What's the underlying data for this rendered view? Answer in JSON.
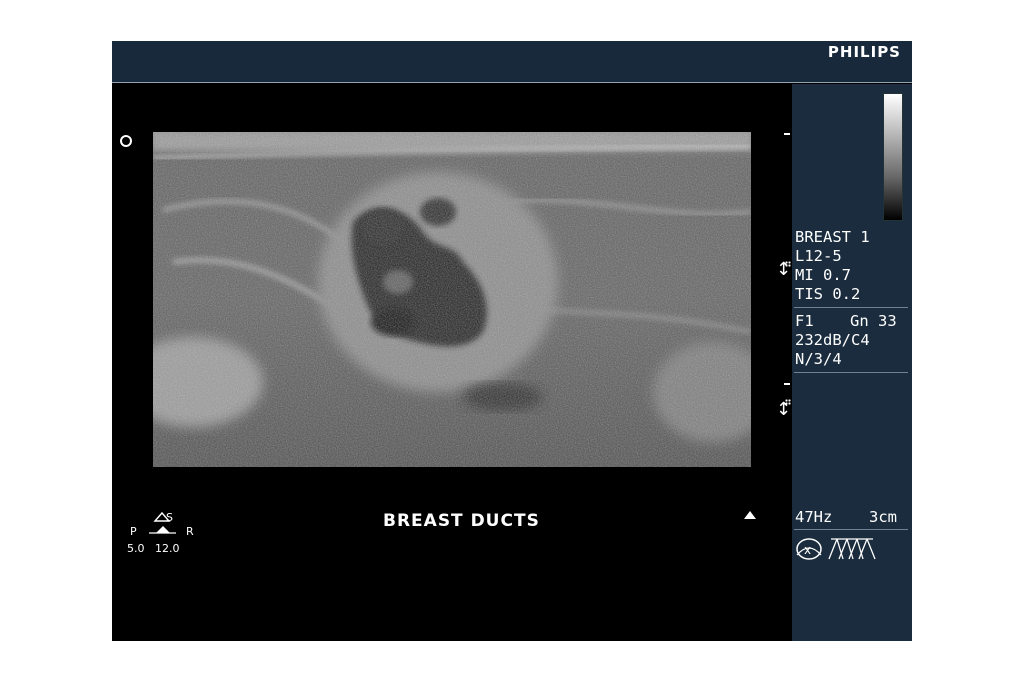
{
  "header": {
    "brand": "PHILIPS"
  },
  "panel": {
    "preset": "BREAST 1",
    "transducer": "L12-5",
    "mi": "MI 0.7",
    "tis": "TIS 0.2",
    "frame": "F1",
    "gain": "Gn 33",
    "dynamic_range": "232dB/C4",
    "persistence": "N/3/4",
    "frame_rate": "47Hz",
    "depth": "3cm"
  },
  "image": {
    "label": "BREAST DUCTS"
  },
  "probe": {
    "top": "S",
    "left": "P",
    "right": "R",
    "val_left": "5.0",
    "val_right": "12.0"
  },
  "icons": {
    "orientation": "orientation-dot-icon",
    "focus": "focus-depth-icon",
    "depth_marker": "depth-marker-triangle-icon",
    "probe": "probe-position-icon",
    "transducer": "transducer-type-icon",
    "greyscale": "greyscale-map-icon"
  }
}
